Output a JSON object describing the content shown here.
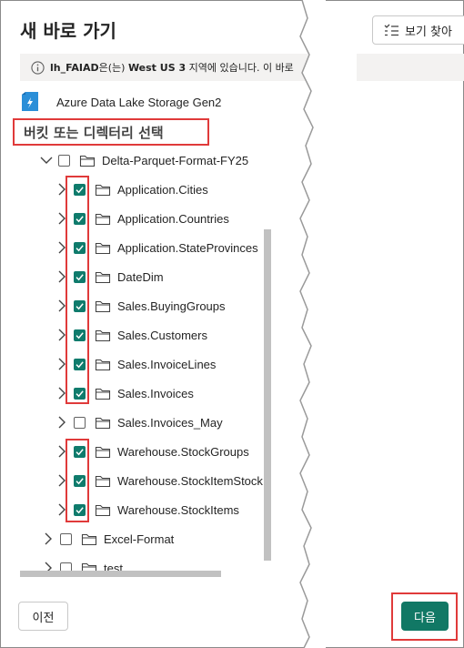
{
  "dialog": {
    "title": "새 바로 가기",
    "view_button_label": "보기 찾아",
    "info": {
      "name": "lh_FAIAD",
      "suffix1": "은(는) ",
      "region": "West US 3",
      "suffix2": " 지역에 있습니다. 이 바로"
    },
    "source_label": "Azure Data Lake Storage Gen2",
    "subtitle": "버킷 또는 디렉터리 선택"
  },
  "tree": [
    {
      "label": "Delta-Parquet-Format-FY25",
      "level": 1,
      "expanded": true,
      "checked": false
    },
    {
      "label": "Application.Cities",
      "level": 2,
      "expanded": false,
      "checked": true
    },
    {
      "label": "Application.Countries",
      "level": 2,
      "expanded": false,
      "checked": true
    },
    {
      "label": "Application.StateProvinces",
      "level": 2,
      "expanded": false,
      "checked": true
    },
    {
      "label": "DateDim",
      "level": 2,
      "expanded": false,
      "checked": true
    },
    {
      "label": "Sales.BuyingGroups",
      "level": 2,
      "expanded": false,
      "checked": true
    },
    {
      "label": "Sales.Customers",
      "level": 2,
      "expanded": false,
      "checked": true
    },
    {
      "label": "Sales.InvoiceLines",
      "level": 2,
      "expanded": false,
      "checked": true
    },
    {
      "label": "Sales.Invoices",
      "level": 2,
      "expanded": false,
      "checked": true
    },
    {
      "label": "Sales.Invoices_May",
      "level": 2,
      "expanded": false,
      "checked": false
    },
    {
      "label": "Warehouse.StockGroups",
      "level": 2,
      "expanded": false,
      "checked": true
    },
    {
      "label": "Warehouse.StockItemStock",
      "level": 2,
      "expanded": false,
      "checked": true
    },
    {
      "label": "Warehouse.StockItems",
      "level": 2,
      "expanded": false,
      "checked": true
    },
    {
      "label": "Excel-Format",
      "level": 0,
      "expanded": false,
      "checked": false
    },
    {
      "label": "test",
      "level": 0,
      "expanded": false,
      "checked": false
    }
  ],
  "footer": {
    "prev_label": "이전",
    "next_label": "다음"
  },
  "colors": {
    "accent": "#117865",
    "highlight": "#e03a3a"
  }
}
